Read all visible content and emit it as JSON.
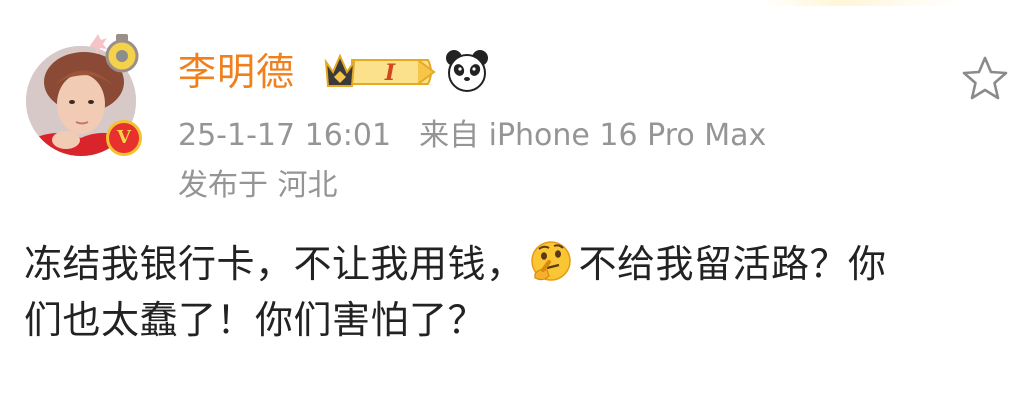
{
  "user": {
    "name": "李明德",
    "avatar_badge": "V",
    "vip_level": "I"
  },
  "post": {
    "timestamp": "25-1-17 16:01",
    "source": "来自 iPhone 16 Pro Max",
    "location": "发布于 河北",
    "text_line1_a": "冻结我银行卡，不让我用钱，",
    "text_line1_b": "不给我留活路？你",
    "text_line2": "们也太蠢了！你们害怕了？"
  },
  "icons": {
    "favorite": "star-outline-icon",
    "emoji": "thinking-face-icon",
    "badge": "panda-icon",
    "vip": "crown-vip-badge"
  },
  "colors": {
    "name": "#f07f1c",
    "meta": "#959595",
    "text": "#222222",
    "verified": "#e8312f"
  }
}
